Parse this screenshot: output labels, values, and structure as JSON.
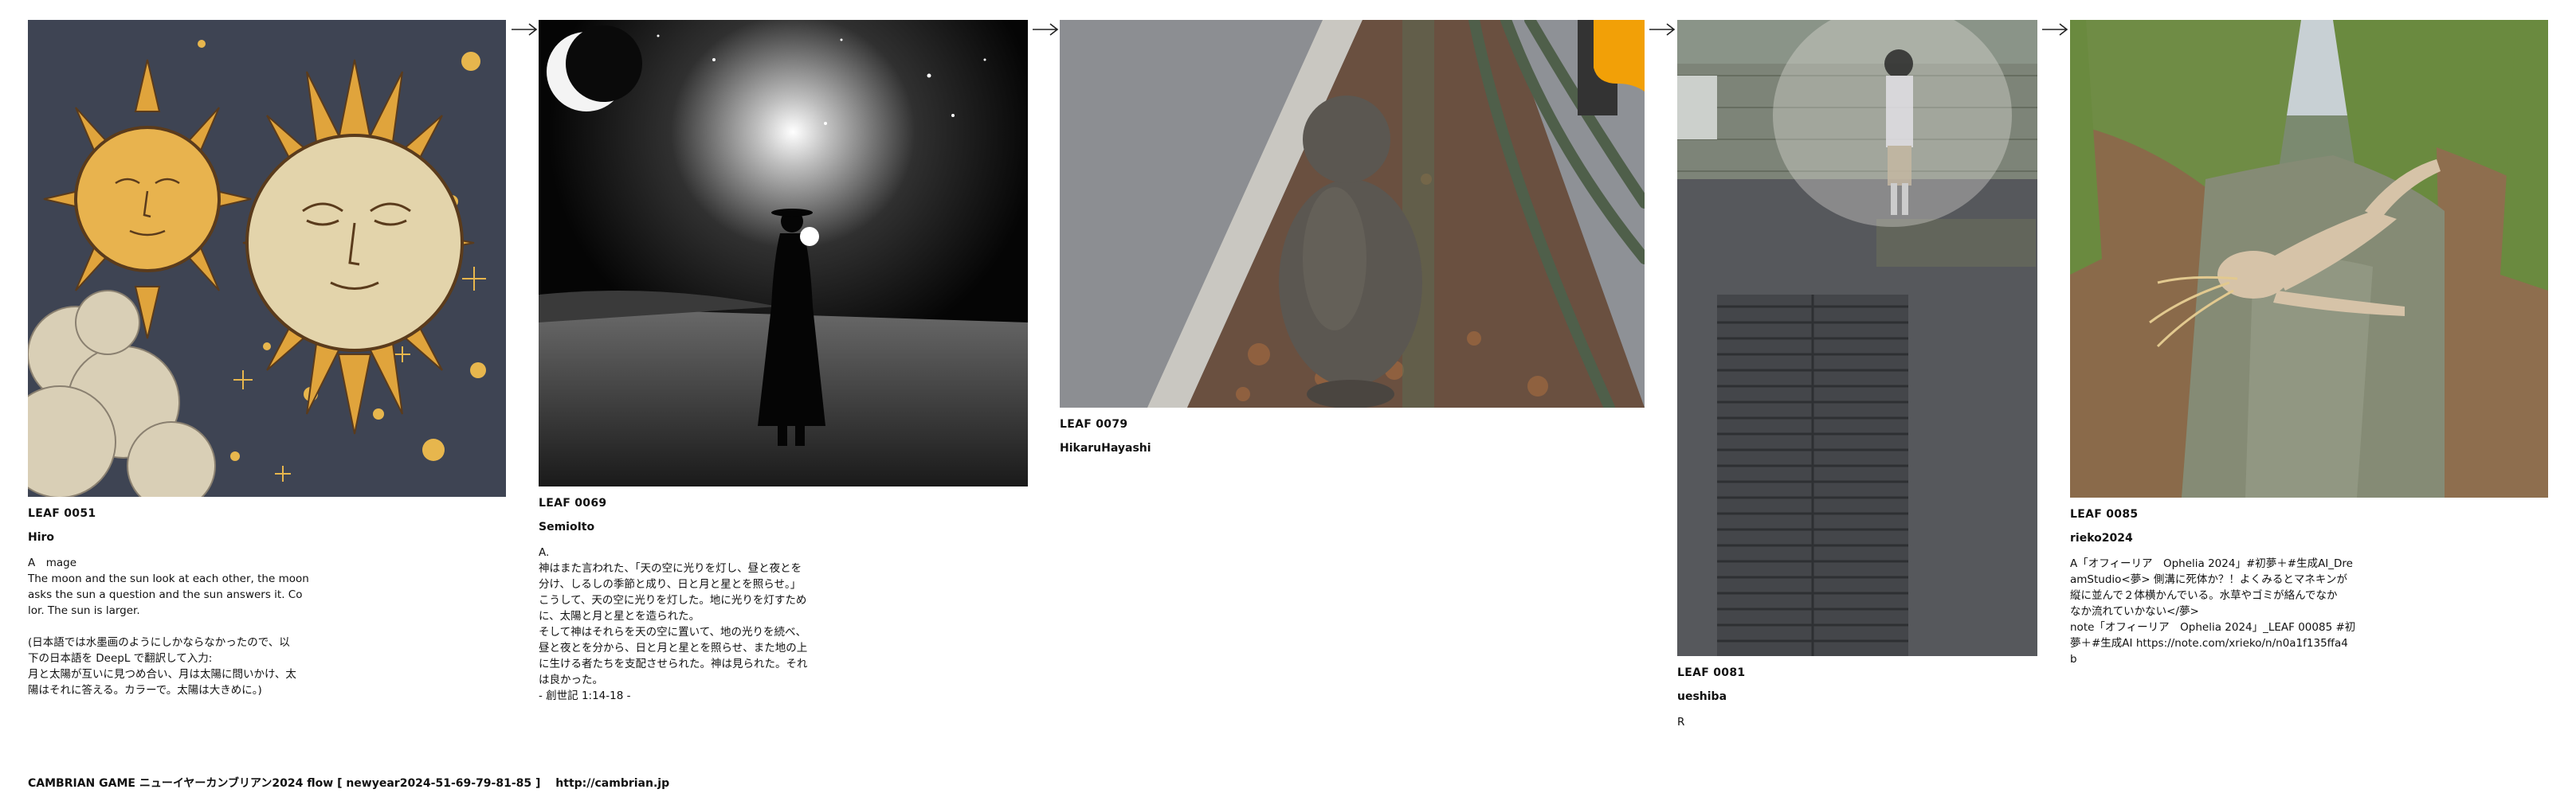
{
  "leaves": [
    {
      "id": "LEAF 0051",
      "author": "Hiro",
      "body": "A　mage\nThe moon and the sun look at each other, the moon\nasks the sun a question and the sun answers it. Co\nlor. The sun is larger.\n\n(日本語では水墨画のようにしかならなかったので、以\n下の日本語を DeepL で翻訳して入力:\n月と太陽が互いに見つめ合い、月は太陽に問いかけ、太\n陽はそれに答える。カラーで。太陽は大きめに。)",
      "image": "sun-and-moon-illustration"
    },
    {
      "id": "LEAF 0069",
      "author": "SemioIto",
      "body": "A.\n神はまた言われた、「天の空に光りを灯し、昼と夜とを\n分け、しるしの季節と成り、日と月と星とを照らせ。」\nこうして、天の空に光りを灯した。地に光りを灯すため\nに、太陽と月と星とを造られた。\nそして神はそれらを天の空に置いて、地の光りを続べ、\n昼と夜とを分から、日と月と星とを照らせ、また地の上\nに生ける者たちを支配させられた。神は見られた。それ\nは良かった。\n- 創世記 1:14-18 -",
      "image": "silhouette-under-moon-photo"
    },
    {
      "id": "LEAF 0079",
      "author": "HikaruHayashi",
      "body": "",
      "image": "monkey-by-guardrail-photo"
    },
    {
      "id": "LEAF 0081",
      "author": "ueshiba",
      "body": "R",
      "image": "ghostly-girl-street-photo"
    },
    {
      "id": "LEAF 0085",
      "author": "rieko2024",
      "body": "A「オフィーリア　Ophelia 2024」#初夢＋#生成AI_Dre\namStudio<夢> 側溝に死体か？！よくみるとマネキンが\n縦に並んで２体横かんでいる。水草やゴミが絡んでなか\nなか流れていかない</夢>\nnote「オフィーリア　Ophelia 2024」_LEAF 00085 #初\n夢＋#生成AI https://note.com/xrieko/n/n0a1f135ffa4\nb",
      "image": "ophelia-in-ditch-photo"
    }
  ],
  "footer": {
    "title": "CAMBRIAN GAME  ニューイヤーカンブリアン2024  flow [ newyear2024-51-69-79-81-85 ]",
    "url": "http://cambrian.jp"
  }
}
